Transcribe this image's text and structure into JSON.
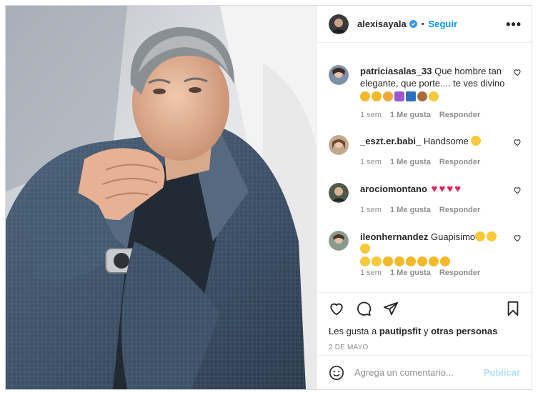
{
  "post": {
    "author": "alexisayala",
    "separator": "•",
    "follow_label": "Seguir",
    "more_label": "•••"
  },
  "comments": [
    {
      "user": "patriciasalas_33",
      "text": "Que hombre tan elegante, que porte.... te ves divino",
      "emojis": [
        "clap",
        "clap",
        "raised-hands",
        "purple-heart",
        "flag",
        "see-no-evil",
        "hushed"
      ],
      "time": "1 sem",
      "likes": "1 Me gusta",
      "reply": "Responder"
    },
    {
      "user": "_eszt.er.babi_",
      "text": "Handsome",
      "emojis": [
        "heart-eyes"
      ],
      "time": "1 sem",
      "likes": "1 Me gusta",
      "reply": "Responder"
    },
    {
      "user": "arociomontano",
      "text": "",
      "emojis": [
        "red-heart",
        "red-heart",
        "red-heart",
        "red-heart"
      ],
      "time": "1 sem",
      "likes": "1 Me gusta",
      "reply": "Responder"
    },
    {
      "user": "ileonhernandez",
      "text": "Guapisimo",
      "emojis": [
        "heart-eyes",
        "heart-eyes",
        "heart-eyes",
        "heart-eyes",
        "heart-eyes",
        "clap",
        "clap",
        "clap",
        "clap",
        "clap",
        "clap"
      ],
      "time": "1 sem",
      "likes": "1 Me gusta",
      "reply": "Responder"
    }
  ],
  "likes_line": {
    "prefix": "Les gusta a",
    "user": "pautipsfit",
    "middle": "y",
    "others": "otras personas"
  },
  "date": "2 DE MAYO",
  "add_comment": {
    "placeholder": "Agrega un comentario...",
    "publish_label": "Publicar"
  },
  "colors": {
    "accent": "#0095f6",
    "publish_disabled": "#b2dffc",
    "verified": "#3897f0",
    "muted": "#8e8e8e"
  },
  "icons": [
    "heart-icon",
    "comment-icon",
    "share-icon",
    "bookmark-icon",
    "emoji-icon",
    "verified-icon",
    "more-icon"
  ]
}
